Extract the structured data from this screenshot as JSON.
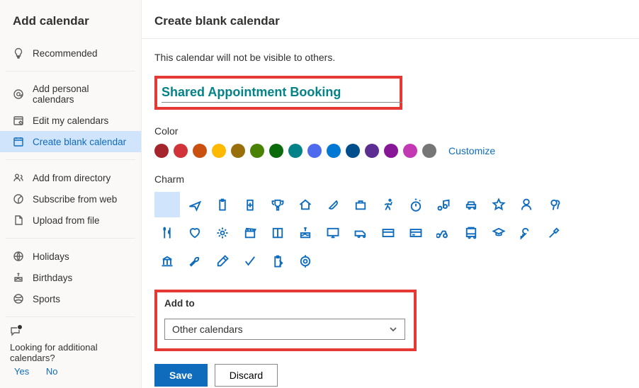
{
  "sidebar": {
    "title": "Add calendar",
    "items": [
      {
        "label": "Recommended",
        "icon": "lightbulb"
      },
      {
        "label": "Add personal calendars",
        "icon": "at"
      },
      {
        "label": "Edit my calendars",
        "icon": "edit-cal"
      },
      {
        "label": "Create blank calendar",
        "icon": "blank-cal",
        "active": true
      },
      {
        "label": "Add from directory",
        "icon": "people"
      },
      {
        "label": "Subscribe from web",
        "icon": "link"
      },
      {
        "label": "Upload from file",
        "icon": "file"
      },
      {
        "label": "Holidays",
        "icon": "globe"
      },
      {
        "label": "Birthdays",
        "icon": "cake"
      },
      {
        "label": "Sports",
        "icon": "ball"
      }
    ],
    "looking": {
      "text": "Looking for additional calendars?",
      "yes": "Yes",
      "no": "No"
    }
  },
  "main": {
    "title": "Create blank calendar",
    "desc": "This calendar will not be visible to others.",
    "calendar_name": "Shared Appointment Booking",
    "color_label": "Color",
    "customize": "Customize",
    "charm_label": "Charm",
    "addto_label": "Add to",
    "addto_value": "Other calendars",
    "save": "Save",
    "discard": "Discard"
  },
  "colors": [
    "#a4262c",
    "#d13438",
    "#ca5010",
    "#ffb900",
    "#986f0b",
    "#498205",
    "#0b6a0b",
    "#038387",
    "#4f6bed",
    "#0078d4",
    "#004e8c",
    "#5c2e91",
    "#881798",
    "#c239b3",
    "#767676"
  ],
  "charms": [
    "none",
    "plane",
    "clipboard",
    "medical",
    "trophy",
    "home",
    "pill",
    "briefcase",
    "run",
    "stopwatch",
    "music",
    "car",
    "star",
    "person",
    "balloons",
    "food",
    "heart",
    "gear",
    "clapper",
    "book",
    "cake",
    "monitor",
    "van",
    "card",
    "credit",
    "bike",
    "bus",
    "grad",
    "key",
    "tools",
    "bank",
    "wrench",
    "shovel",
    "check",
    "clipboard2",
    "target"
  ]
}
